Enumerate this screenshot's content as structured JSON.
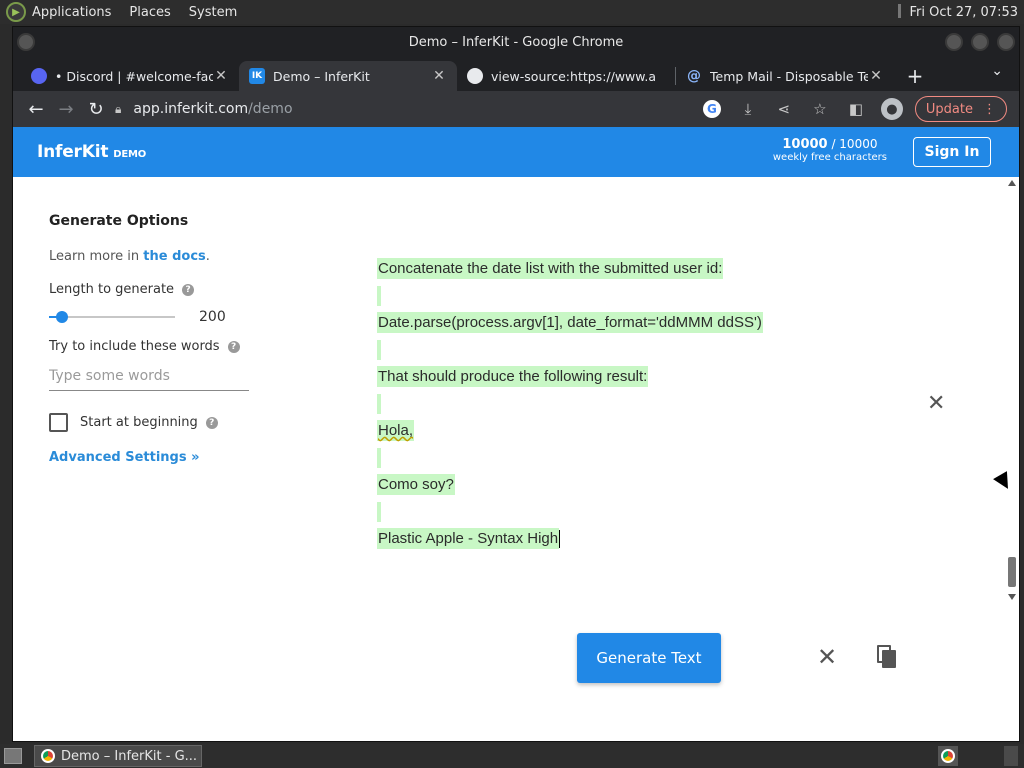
{
  "topbar": {
    "menus": [
      "Applications",
      "Places",
      "System"
    ],
    "clock": "Fri Oct 27, 07:53"
  },
  "window": {
    "title": "Demo – InferKit - Google Chrome"
  },
  "tabs": [
    {
      "title": "• Discord | #welcome-faq |",
      "icon": "discord-icon",
      "active": false
    },
    {
      "title": "Demo – InferKit",
      "icon": "inferkit-icon",
      "icon_text": "IK",
      "active": true
    },
    {
      "title": "view-source:https://www.a",
      "icon": "chrome-icon",
      "active": false
    },
    {
      "title": "Temp Mail - Disposable Te",
      "icon": "at-sign-icon",
      "active": false
    }
  ],
  "toolbar": {
    "url_host": "app.inferkit.com",
    "url_path": "/demo",
    "update_label": "Update"
  },
  "app": {
    "brand": "InferKit",
    "brand_tag": "DEMO",
    "quota_used": "10000",
    "quota_total": "/ 10000",
    "quota_caption": "weekly free characters",
    "signin_label": "Sign In"
  },
  "options": {
    "title": "Generate Options",
    "learn_prefix": "Learn more in ",
    "learn_link": "the docs",
    "learn_suffix": ".",
    "length_label": "Length to generate",
    "length_value": "200",
    "length_fraction": 0.1,
    "include_label": "Try to include these words",
    "include_placeholder": "Type some words",
    "start_label": "Start at beginning",
    "advanced_label": "Advanced Settings »"
  },
  "editor": {
    "lines": [
      "Concatenate the date list with the submitted user id:",
      "",
      "Date.parse(process.argv[1], date_format='ddMMM ddSS')",
      "",
      "That should produce the following result:",
      "",
      "Hola,",
      "",
      "Como soy?",
      "",
      "Plastic Apple - Syntax High"
    ]
  },
  "actions": {
    "generate_label": "Generate Text"
  },
  "taskbar": {
    "item": "Demo – InferKit - G..."
  },
  "colors": {
    "accent": "#2188e6",
    "highlight": "#c8f7c5"
  }
}
